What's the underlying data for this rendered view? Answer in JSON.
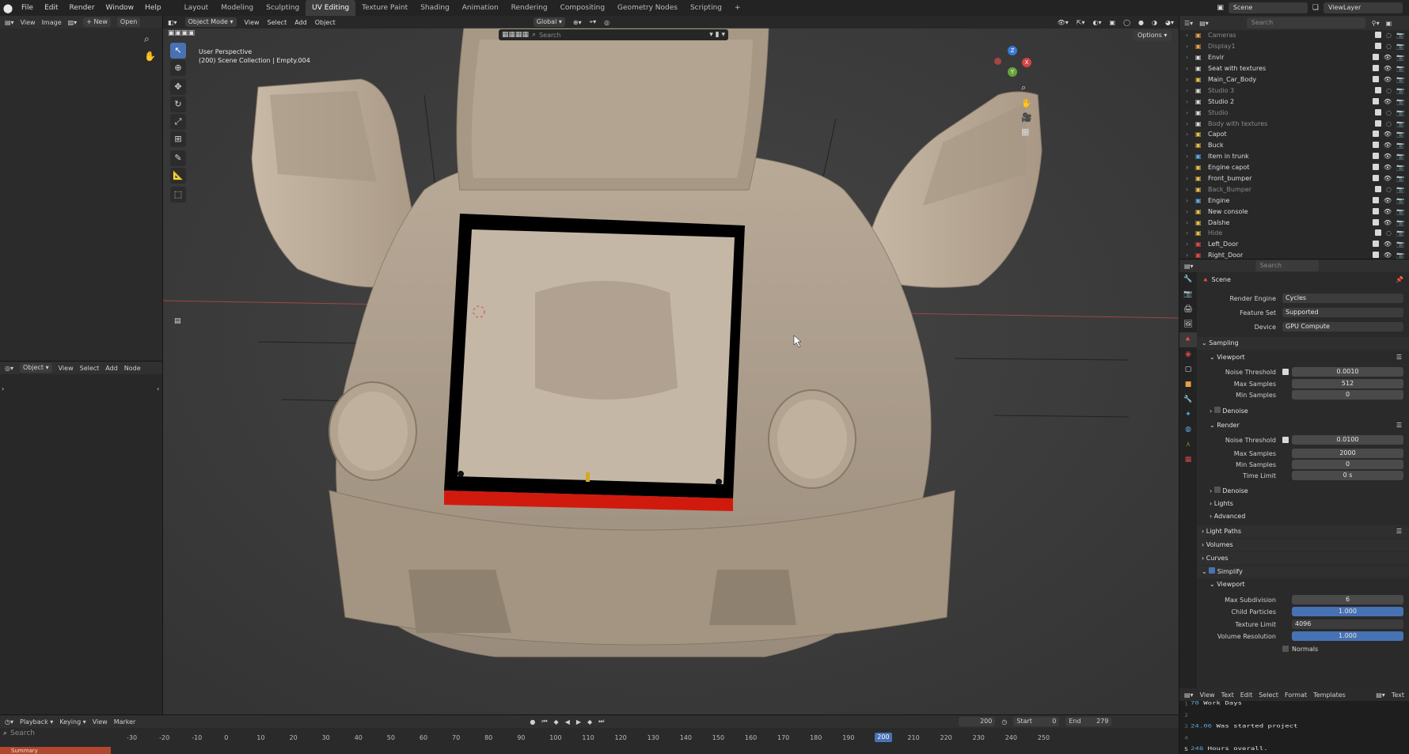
{
  "menubar": {
    "menus": [
      "File",
      "Edit",
      "Render",
      "Window",
      "Help"
    ],
    "workspaces": [
      "Layout",
      "Modeling",
      "Sculpting",
      "UV Editing",
      "Texture Paint",
      "Shading",
      "Animation",
      "Rendering",
      "Compositing",
      "Geometry Nodes",
      "Scripting"
    ],
    "active_workspace": "UV Editing",
    "add_tab": "+",
    "scene": "Scene",
    "view_layer": "ViewLayer"
  },
  "image_editor": {
    "menus": [
      "View",
      "Image"
    ],
    "new_label": "+ New",
    "open_label": "Open"
  },
  "lower_left": {
    "mode": "Object",
    "menus": [
      "View",
      "Select",
      "Add",
      "Node"
    ]
  },
  "viewport": {
    "mode": "Object Mode",
    "menus": [
      "View",
      "Select",
      "Add",
      "Object"
    ],
    "orientation": "Global",
    "search_placeholder": "Search",
    "options_label": "Options",
    "perspective": "User Perspective",
    "collection": "(200) Scene Collection | Empty.004",
    "gizmo": {
      "x": "X",
      "y": "Y",
      "z": "Z"
    }
  },
  "outliner": {
    "search_placeholder": "Search",
    "items": [
      {
        "name": "Cameras",
        "dim": true,
        "color": "#e8a04a"
      },
      {
        "name": "Display1",
        "dim": true,
        "color": "#e8a04a"
      },
      {
        "name": "Envir",
        "dim": false,
        "color": "#d8d8d8"
      },
      {
        "name": "Seat with textures",
        "dim": false,
        "color": "#d8d8d8"
      },
      {
        "name": "Main_Car_Body",
        "dim": false,
        "color": "#e8c14a"
      },
      {
        "name": "Studio 3",
        "dim": true,
        "color": "#d8d8d8"
      },
      {
        "name": "Studio 2",
        "dim": false,
        "color": "#d8d8d8"
      },
      {
        "name": "Studio",
        "dim": true,
        "color": "#d8d8d8"
      },
      {
        "name": "Body with textures",
        "dim": true,
        "color": "#d8d8d8"
      },
      {
        "name": "Capot",
        "dim": false,
        "color": "#e8c14a"
      },
      {
        "name": "Buck",
        "dim": false,
        "color": "#e8c14a"
      },
      {
        "name": "Item in trunk",
        "dim": false,
        "color": "#5ca9e8"
      },
      {
        "name": "Engine capot",
        "dim": false,
        "color": "#e8c14a"
      },
      {
        "name": "Front_bumper",
        "dim": false,
        "color": "#e8c14a"
      },
      {
        "name": "Back_Bumper",
        "dim": true,
        "color": "#e8c14a"
      },
      {
        "name": "Engine",
        "dim": false,
        "color": "#5ca9e8"
      },
      {
        "name": "New console",
        "dim": false,
        "color": "#e8c14a"
      },
      {
        "name": "Dalshe",
        "dim": false,
        "color": "#e8c14a"
      },
      {
        "name": "Hide",
        "dim": true,
        "color": "#e8c14a"
      },
      {
        "name": "Left_Door",
        "dim": false,
        "color": "#e84a4a"
      },
      {
        "name": "Right_Door",
        "dim": false,
        "color": "#e84a4a"
      }
    ]
  },
  "properties": {
    "search_placeholder": "Search",
    "context": "Scene",
    "render_engine_label": "Render Engine",
    "render_engine": "Cycles",
    "feature_set_label": "Feature Set",
    "feature_set": "Supported",
    "device_label": "Device",
    "device": "GPU Compute",
    "sampling": "Sampling",
    "viewport": "Viewport",
    "noise_threshold_label": "Noise Threshold",
    "vp_noise_threshold": "0.0010",
    "max_samples_label": "Max Samples",
    "vp_max_samples": "512",
    "min_samples_label": "Min Samples",
    "vp_min_samples": "0",
    "denoise": "Denoise",
    "render": "Render",
    "r_noise_threshold": "0.0100",
    "r_max_samples": "2000",
    "r_min_samples": "0",
    "time_limit_label": "Time Limit",
    "r_time_limit": "0 s",
    "lights": "Lights",
    "advanced": "Advanced",
    "light_paths": "Light Paths",
    "volumes": "Volumes",
    "curves": "Curves",
    "simplify": "Simplify",
    "simplify_viewport": "Viewport",
    "max_subdivision_label": "Max Subdivision",
    "max_subdivision": "6",
    "child_particles_label": "Child Particles",
    "child_particles": "1.000",
    "texture_limit_label": "Texture Limit",
    "texture_limit": "4096",
    "volume_resolution_label": "Volume Resolution",
    "volume_resolution": "1.000",
    "normals": "Normals"
  },
  "text_editor": {
    "menus": [
      "View",
      "Text",
      "Edit",
      "Select",
      "Format",
      "Templates"
    ],
    "text_label": "Text",
    "lines": [
      {
        "num": "1",
        "num_text": "70",
        "text": " Work Days"
      },
      {
        "num": "2",
        "num_text": "",
        "text": ""
      },
      {
        "num": "3",
        "num_text": "24.06",
        "text": " Was started project"
      },
      {
        "num": "4",
        "num_text": "",
        "text": ""
      },
      {
        "num": "5",
        "num_text": "248",
        "text": " Hours overall."
      }
    ]
  },
  "timeline": {
    "menus": [
      "Playback",
      "Keying",
      "View",
      "Marker"
    ],
    "search_placeholder": "Search",
    "summary": "Summary",
    "current_frame": "200",
    "start_label": "Start",
    "start": "0",
    "end_label": "End",
    "end": "279",
    "ruler": [
      "-30",
      "-20",
      "-10",
      "0",
      "10",
      "20",
      "30",
      "40",
      "50",
      "60",
      "70",
      "80",
      "90",
      "100",
      "110",
      "120",
      "130",
      "140",
      "150",
      "160",
      "170",
      "180",
      "190",
      "200",
      "210",
      "220",
      "230",
      "240",
      "250"
    ]
  }
}
